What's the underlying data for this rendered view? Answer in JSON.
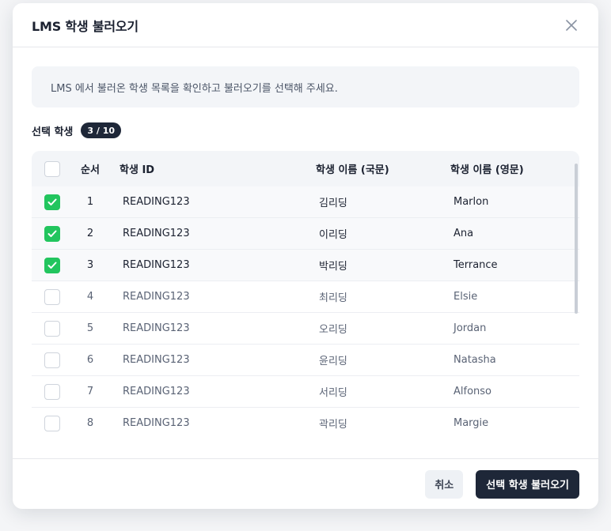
{
  "dialog": {
    "title": "LMS 학생 불러오기",
    "close_icon": "close-icon",
    "notice": "LMS 에서 불러온 학생 목록을 확인하고 불러오기를 선택해 주세요.",
    "selected_label": "선택 학생",
    "selected_count": "3 / 10"
  },
  "table": {
    "headers": {
      "no": "순서",
      "id": "학생 ID",
      "name_kr": "학생 이름 (국문)",
      "name_en": "학생 이름 (영문)"
    },
    "rows": [
      {
        "checked": true,
        "no": "1",
        "id": "READING123",
        "name_kr": "김리딩",
        "name_en": "Marlon"
      },
      {
        "checked": true,
        "no": "2",
        "id": "READING123",
        "name_kr": "이리딩",
        "name_en": "Ana"
      },
      {
        "checked": true,
        "no": "3",
        "id": "READING123",
        "name_kr": "박리딩",
        "name_en": "Terrance"
      },
      {
        "checked": false,
        "no": "4",
        "id": "READING123",
        "name_kr": "최리딩",
        "name_en": "Elsie"
      },
      {
        "checked": false,
        "no": "5",
        "id": "READING123",
        "name_kr": "오리딩",
        "name_en": "Jordan"
      },
      {
        "checked": false,
        "no": "6",
        "id": "READING123",
        "name_kr": "윤리딩",
        "name_en": "Natasha"
      },
      {
        "checked": false,
        "no": "7",
        "id": "READING123",
        "name_kr": "서리딩",
        "name_en": "Alfonso"
      },
      {
        "checked": false,
        "no": "8",
        "id": "READING123",
        "name_kr": "곽리딩",
        "name_en": "Margie"
      }
    ]
  },
  "footer": {
    "cancel_label": "취소",
    "confirm_label": "선택 학생 불러오기"
  },
  "colors": {
    "check_on": "#22c55e",
    "primary": "#1e2738"
  }
}
